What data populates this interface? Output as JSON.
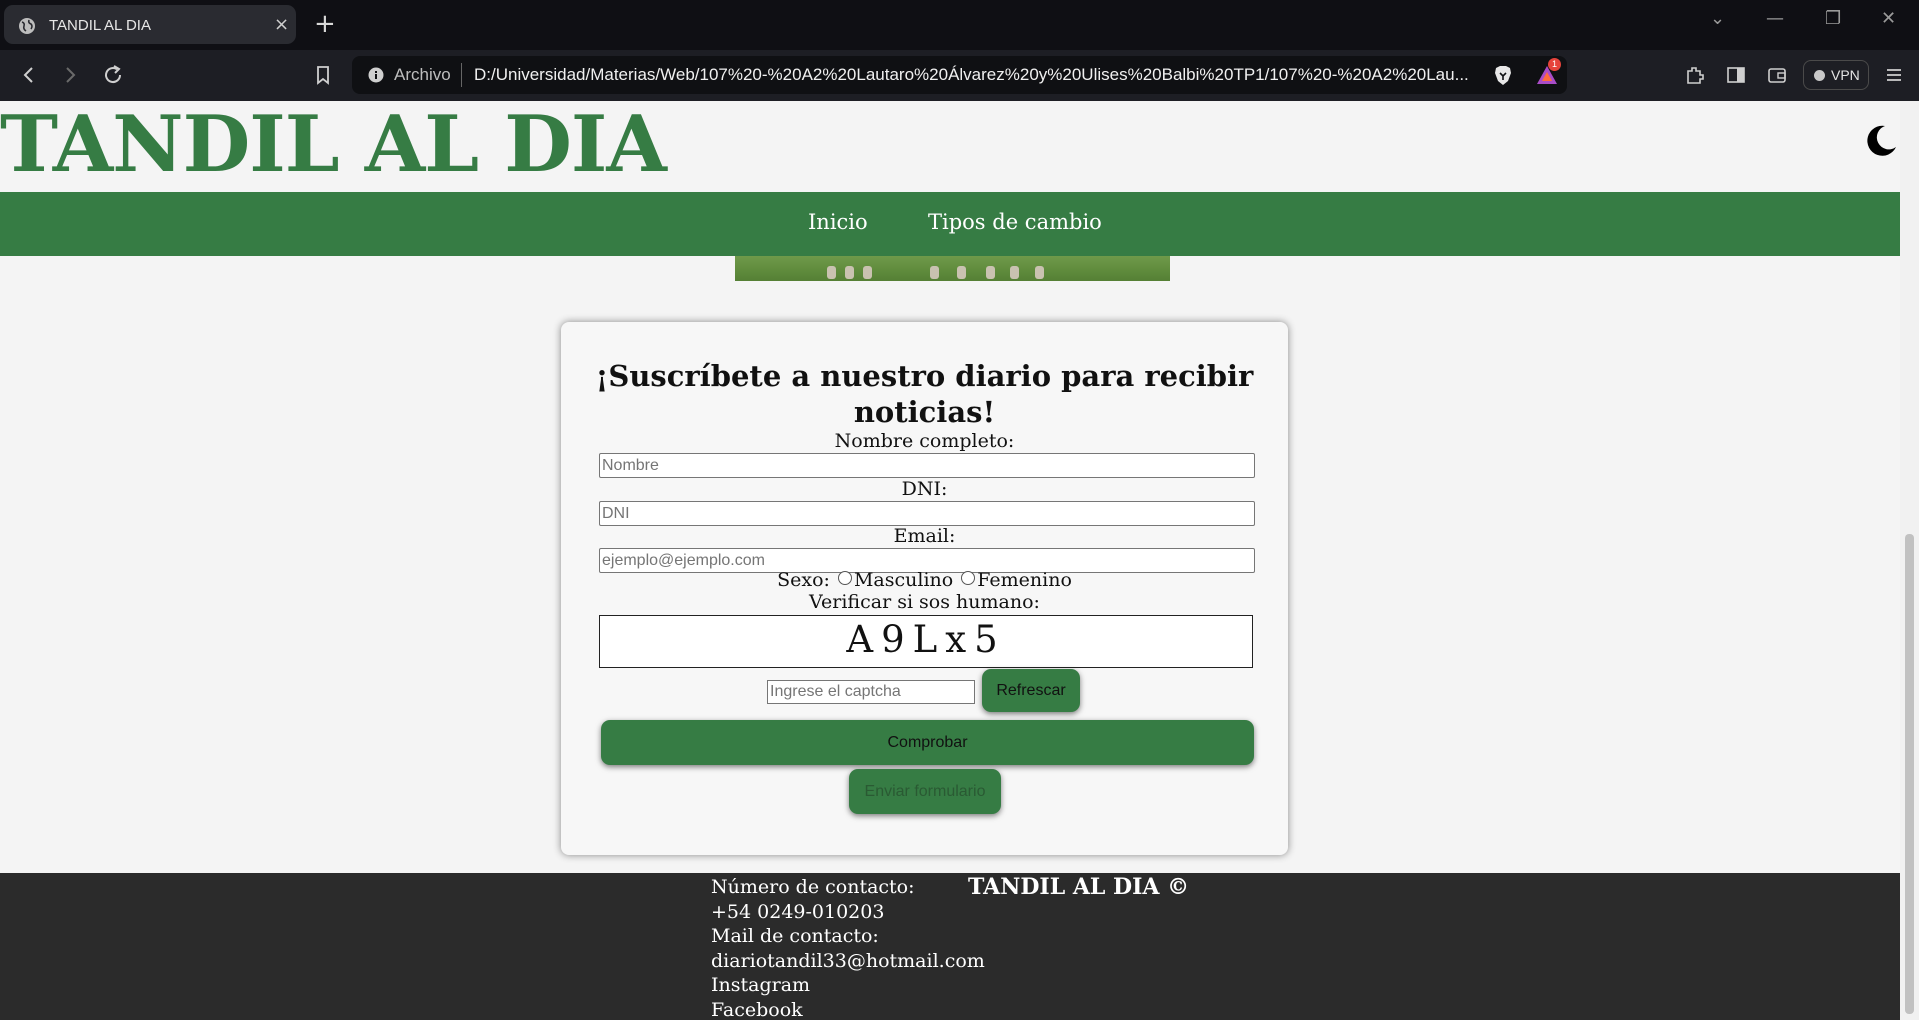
{
  "browser": {
    "tab_title": "TANDIL AL DIA",
    "tab_close": "×",
    "new_tab": "+",
    "win_controls": [
      "⌄",
      "—",
      "❐",
      "✕"
    ],
    "address_scheme_label": "Archivo",
    "address_url": "D:/Universidad/Materias/Web/107%20-%20A2%20Lautaro%20Álvarez%20y%20Ulises%20Balbi%20TP1/107%20-%20A2%20Lau...",
    "rewards_badge": "1",
    "vpn_label": "VPN"
  },
  "site": {
    "title": "TANDIL AL DIA",
    "accent_color": "#367c44"
  },
  "menu": {
    "items": [
      {
        "label": "Inicio"
      },
      {
        "label": "Tipos de cambio"
      }
    ]
  },
  "form": {
    "heading_line1": "¡Suscríbete a nuestro diario para recibir",
    "heading_line2": "noticias!",
    "name_label": "Nombre completo:",
    "name_placeholder": "Nombre",
    "dni_label": "DNI:",
    "dni_placeholder": "DNI",
    "email_label": "Email:",
    "email_placeholder": "ejemplo@ejemplo.com",
    "sexo_label": "Sexo:",
    "sexo_options": [
      "Masculino",
      "Femenino"
    ],
    "captcha_label": "Verificar si sos humano:",
    "captcha_text": "A9Lx5",
    "captcha_placeholder": "Ingrese el captcha",
    "refresh_button": "Refrescar",
    "check_button": "Comprobar",
    "submit_button": "Enviar formulario"
  },
  "footer": {
    "contact_number_label": "Número de contacto:",
    "contact_number": "+54 0249-010203",
    "contact_mail_label": "Mail de contacto:",
    "contact_mail": "diariotandil33@hotmail.com",
    "instagram": "Instagram",
    "facebook": "Facebook",
    "brand": "TANDIL AL DIA ©"
  }
}
